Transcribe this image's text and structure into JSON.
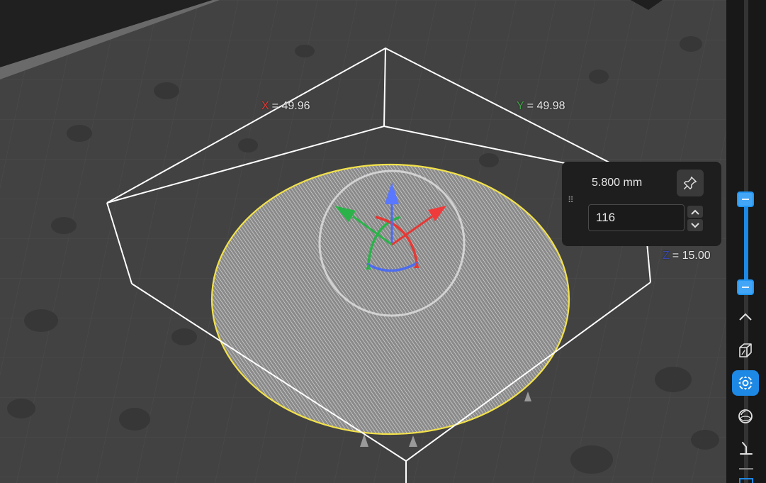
{
  "viewport": {
    "dimensions": {
      "x": {
        "axis": "X",
        "value": "= 49.96",
        "axis_color": "#e53935"
      },
      "y": {
        "axis": "Y",
        "value": "= 49.98",
        "axis_color": "#43a047"
      },
      "z": {
        "axis": "Z",
        "value": "= 15.00",
        "axis_color": "#3949ab"
      }
    },
    "selection_color": "#f2e14b",
    "gizmo_colors": {
      "x": "#e53935",
      "y": "#2bb34a",
      "z": "#4d6cf0"
    }
  },
  "layer_panel": {
    "height_label": "5.800 mm",
    "layer_number": "116",
    "pin_icon": "pin-icon",
    "drag_handle_icon": "drag-handle-icon"
  },
  "toolbar": {
    "accent": "#1e88e5",
    "slider": {
      "top_level": 0.588,
      "bottom_level": 0.405
    },
    "tools": [
      {
        "name": "collapse",
        "icon": "chevron-up-icon",
        "active": false
      },
      {
        "name": "view-3d",
        "icon": "cube-view-icon",
        "active": false
      },
      {
        "name": "camera-orbit",
        "icon": "orbit-camera-icon",
        "active": true
      },
      {
        "name": "sphere-view",
        "icon": "sphere-icon",
        "active": false
      },
      {
        "name": "supports",
        "icon": "support-icon",
        "active": false
      }
    ]
  }
}
